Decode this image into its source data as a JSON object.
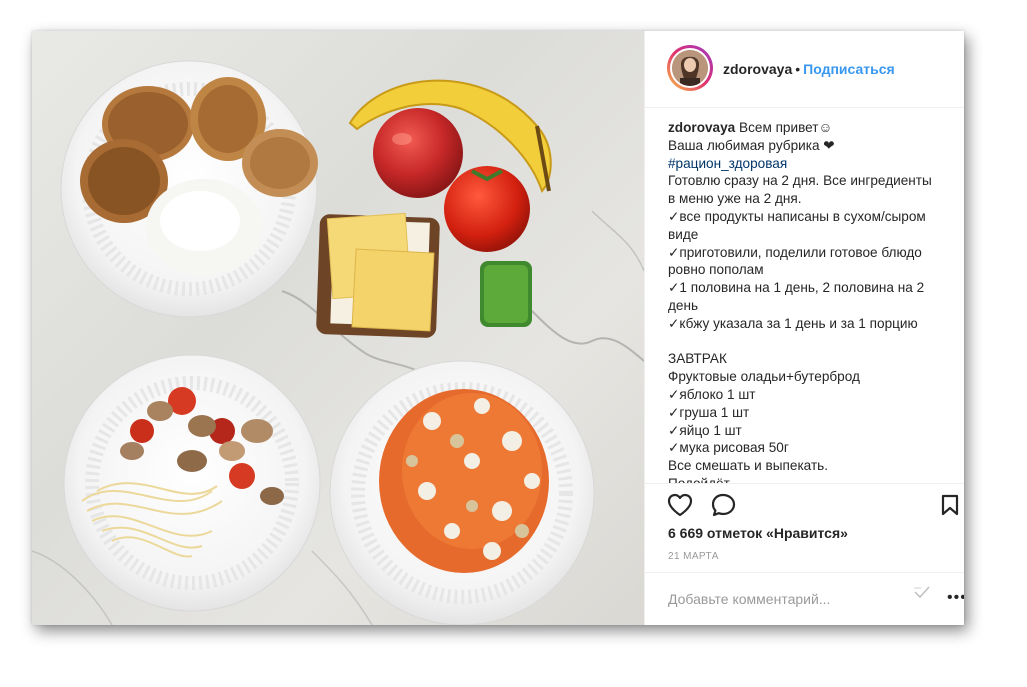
{
  "post": {
    "username": "zdorovaya",
    "separator": "•",
    "follow_label": "Подписаться"
  },
  "caption": {
    "username": "zdorovaya",
    "first_line": " Всем привет☺",
    "lines": [
      "Ваша любимая рубрика ❤",
      "#рацион_здоровая",
      "Готовлю сразу на 2 дня. Все ингредиенты",
      "в меню уже на 2 дня.",
      "✓все продукты написаны в сухом/сыром",
      "виде",
      "✓приготовили, поделили готовое блюдо",
      "ровно пополам",
      "✓1 половина на 1 день, 2 половина на 2",
      "день",
      "✓кбжу указала за 1 день и за 1 порцию",
      "",
      "ЗАВТРАК",
      "Фруктовые оладьи+бутерброд",
      "✓яблоко 1 шт",
      "✓груша 1 шт",
      "✓яйцо 1 шт",
      "✓мука рисовая 50г",
      "Все смешать и выпекать.",
      "Подойдёт"
    ]
  },
  "stats": {
    "likes": "6 669 отметок «Нравится»",
    "date": "21 МАРТА"
  },
  "comment": {
    "placeholder": "Добавьте комментарий...",
    "more": "•••"
  },
  "icons": {
    "like": "heart-icon",
    "comment": "comment-icon",
    "save": "bookmark-icon",
    "submit": "send-check-icon"
  }
}
